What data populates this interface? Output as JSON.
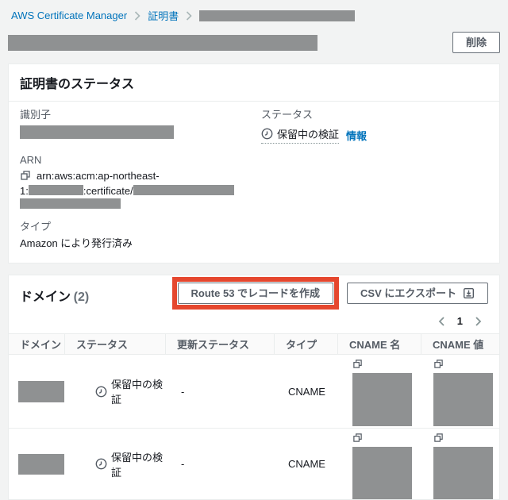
{
  "colors": {
    "accent_blue": "#0073bb",
    "highlight_red": "#e5472e",
    "redaction_gray": "#8f9192",
    "panel_border": "#eaeded",
    "page_background": "#f2f3f3"
  },
  "breadcrumb": {
    "item1": "AWS Certificate Manager",
    "item2": "証明書"
  },
  "header": {
    "delete_label": "削除"
  },
  "certificate_panel": {
    "title": "証明書のステータス",
    "identifier_label": "識別子",
    "status_label": "ステータス",
    "status_value": "保留中の検証",
    "info_link": "情報",
    "arn_label": "ARN",
    "arn_line1": "arn:aws:acm:ap-northeast-",
    "arn_line2_prefix": "1:",
    "arn_line2_mid": ":certificate/",
    "type_label": "タイプ",
    "type_value": "Amazon により発行済み"
  },
  "domains_panel": {
    "title": "ドメイン",
    "count": "(2)",
    "route53_button": "Route 53 でレコードを作成",
    "export_button": "CSV にエクスポート",
    "pagination": {
      "page": "1"
    },
    "table": {
      "headers": [
        "ドメイン",
        "ステータス",
        "更新ステータス",
        "タイプ",
        "CNAME 名",
        "CNAME 値"
      ],
      "rows": [
        {
          "status": "保留中の検証",
          "renewal_status": "-",
          "type": "CNAME"
        },
        {
          "status": "保留中の検証",
          "renewal_status": "-",
          "type": "CNAME"
        }
      ]
    }
  }
}
